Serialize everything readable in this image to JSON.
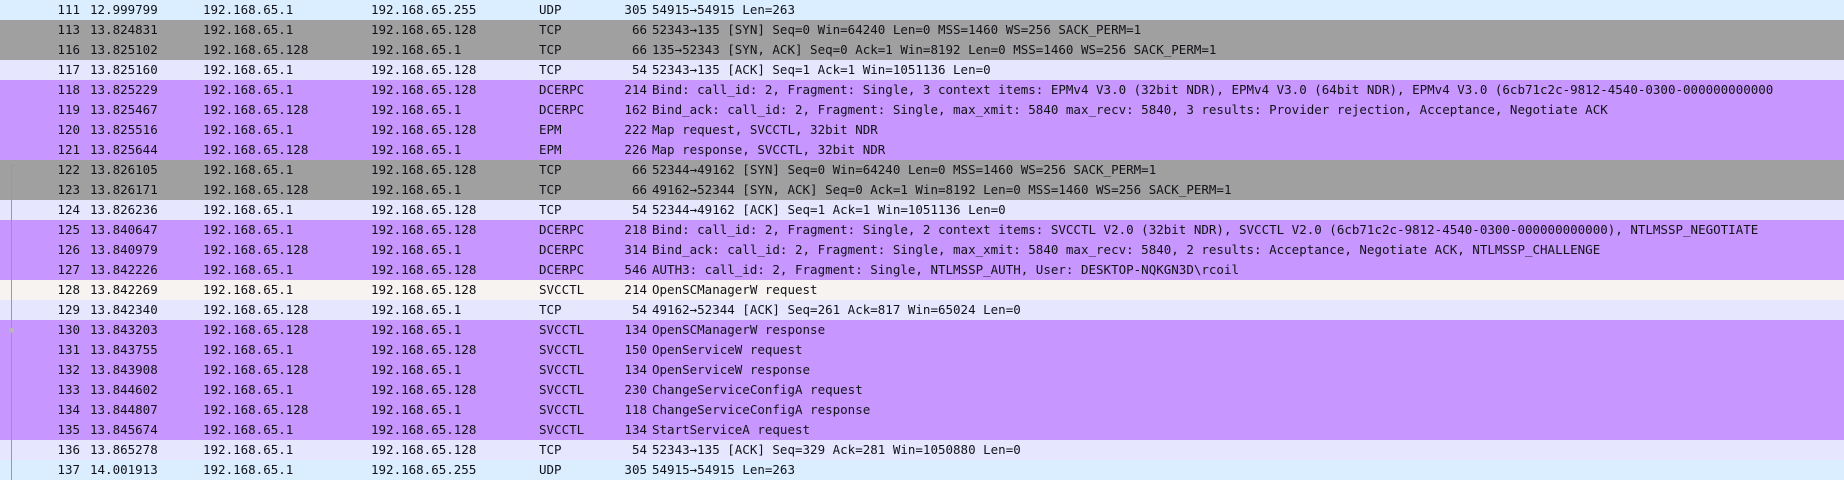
{
  "packets": [
    {
      "no": "111",
      "time": "12.999799",
      "source": "192.168.65.1",
      "destination": "192.168.65.255",
      "protocol": "UDP",
      "length": "305",
      "info": "54915→54915 Len=263",
      "color": "#daeeff"
    },
    {
      "no": "113",
      "time": "13.824831",
      "source": "192.168.65.1",
      "destination": "192.168.65.128",
      "protocol": "TCP",
      "length": "66",
      "info": "52343→135 [SYN] Seq=0 Win=64240 Len=0 MSS=1460 WS=256 SACK_PERM=1",
      "color": "#a0a0a0"
    },
    {
      "no": "116",
      "time": "13.825102",
      "source": "192.168.65.128",
      "destination": "192.168.65.1",
      "protocol": "TCP",
      "length": "66",
      "info": "135→52343 [SYN, ACK] Seq=0 Ack=1 Win=8192 Len=0 MSS=1460 WS=256 SACK_PERM=1",
      "color": "#a0a0a0"
    },
    {
      "no": "117",
      "time": "13.825160",
      "source": "192.168.65.1",
      "destination": "192.168.65.128",
      "protocol": "TCP",
      "length": "54",
      "info": "52343→135 [ACK] Seq=1 Ack=1 Win=1051136 Len=0",
      "color": "#e7e6ff"
    },
    {
      "no": "118",
      "time": "13.825229",
      "source": "192.168.65.1",
      "destination": "192.168.65.128",
      "protocol": "DCERPC",
      "length": "214",
      "info": "Bind: call_id: 2, Fragment: Single, 3 context items: EPMv4 V3.0 (32bit NDR), EPMv4 V3.0 (64bit NDR), EPMv4 V3.0 (6cb71c2c-9812-4540-0300-000000000000",
      "color": "#c797ff"
    },
    {
      "no": "119",
      "time": "13.825467",
      "source": "192.168.65.128",
      "destination": "192.168.65.1",
      "protocol": "DCERPC",
      "length": "162",
      "info": "Bind_ack: call_id: 2, Fragment: Single, max_xmit: 5840 max_recv: 5840, 3 results: Provider rejection, Acceptance, Negotiate ACK",
      "color": "#c797ff"
    },
    {
      "no": "120",
      "time": "13.825516",
      "source": "192.168.65.1",
      "destination": "192.168.65.128",
      "protocol": "EPM",
      "length": "222",
      "info": "Map request, SVCCTL, 32bit NDR",
      "color": "#c797ff"
    },
    {
      "no": "121",
      "time": "13.825644",
      "source": "192.168.65.128",
      "destination": "192.168.65.1",
      "protocol": "EPM",
      "length": "226",
      "info": "Map response, SVCCTL, 32bit NDR",
      "color": "#c797ff"
    },
    {
      "no": "122",
      "time": "13.826105",
      "source": "192.168.65.1",
      "destination": "192.168.65.128",
      "protocol": "TCP",
      "length": "66",
      "info": "52344→49162 [SYN] Seq=0 Win=64240 Len=0 MSS=1460 WS=256 SACK_PERM=1",
      "color": "#a0a0a0"
    },
    {
      "no": "123",
      "time": "13.826171",
      "source": "192.168.65.128",
      "destination": "192.168.65.1",
      "protocol": "TCP",
      "length": "66",
      "info": "49162→52344 [SYN, ACK] Seq=0 Ack=1 Win=8192 Len=0 MSS=1460 WS=256 SACK_PERM=1",
      "color": "#a0a0a0"
    },
    {
      "no": "124",
      "time": "13.826236",
      "source": "192.168.65.1",
      "destination": "192.168.65.128",
      "protocol": "TCP",
      "length": "54",
      "info": "52344→49162 [ACK] Seq=1 Ack=1 Win=1051136 Len=0",
      "color": "#e7e6ff"
    },
    {
      "no": "125",
      "time": "13.840647",
      "source": "192.168.65.1",
      "destination": "192.168.65.128",
      "protocol": "DCERPC",
      "length": "218",
      "info": "Bind: call_id: 2, Fragment: Single, 2 context items: SVCCTL V2.0 (32bit NDR), SVCCTL V2.0 (6cb71c2c-9812-4540-0300-000000000000), NTLMSSP_NEGOTIATE",
      "color": "#c797ff"
    },
    {
      "no": "126",
      "time": "13.840979",
      "source": "192.168.65.128",
      "destination": "192.168.65.1",
      "protocol": "DCERPC",
      "length": "314",
      "info": "Bind_ack: call_id: 2, Fragment: Single, max_xmit: 5840 max_recv: 5840, 2 results: Acceptance, Negotiate ACK, NTLMSSP_CHALLENGE",
      "color": "#c797ff"
    },
    {
      "no": "127",
      "time": "13.842226",
      "source": "192.168.65.1",
      "destination": "192.168.65.128",
      "protocol": "DCERPC",
      "length": "546",
      "info": "AUTH3: call_id: 2, Fragment: Single, NTLMSSP_AUTH, User: DESKTOP-NQKGN3D\\rcoil",
      "color": "#c797ff"
    },
    {
      "no": "128",
      "time": "13.842269",
      "source": "192.168.65.1",
      "destination": "192.168.65.128",
      "protocol": "SVCCTL",
      "length": "214",
      "info": "OpenSCManagerW request",
      "color": "#f6f3f0"
    },
    {
      "no": "129",
      "time": "13.842340",
      "source": "192.168.65.128",
      "destination": "192.168.65.1",
      "protocol": "TCP",
      "length": "54",
      "info": "49162→52344 [ACK] Seq=261 Ack=817 Win=65024 Len=0",
      "color": "#e7e6ff"
    },
    {
      "no": "130",
      "time": "13.843203",
      "source": "192.168.65.128",
      "destination": "192.168.65.1",
      "protocol": "SVCCTL",
      "length": "134",
      "info": "OpenSCManagerW response",
      "color": "#c797ff"
    },
    {
      "no": "131",
      "time": "13.843755",
      "source": "192.168.65.1",
      "destination": "192.168.65.128",
      "protocol": "SVCCTL",
      "length": "150",
      "info": "OpenServiceW request",
      "color": "#c797ff"
    },
    {
      "no": "132",
      "time": "13.843908",
      "source": "192.168.65.128",
      "destination": "192.168.65.1",
      "protocol": "SVCCTL",
      "length": "134",
      "info": "OpenServiceW response",
      "color": "#c797ff"
    },
    {
      "no": "133",
      "time": "13.844602",
      "source": "192.168.65.1",
      "destination": "192.168.65.128",
      "protocol": "SVCCTL",
      "length": "230",
      "info": "ChangeServiceConfigA request",
      "color": "#c797ff"
    },
    {
      "no": "134",
      "time": "13.844807",
      "source": "192.168.65.128",
      "destination": "192.168.65.1",
      "protocol": "SVCCTL",
      "length": "118",
      "info": "ChangeServiceConfigA response",
      "color": "#c797ff"
    },
    {
      "no": "135",
      "time": "13.845674",
      "source": "192.168.65.1",
      "destination": "192.168.65.128",
      "protocol": "SVCCTL",
      "length": "134",
      "info": "StartServiceA request",
      "color": "#c797ff"
    },
    {
      "no": "136",
      "time": "13.865278",
      "source": "192.168.65.1",
      "destination": "192.168.65.128",
      "protocol": "TCP",
      "length": "54",
      "info": "52343→135 [ACK] Seq=329 Ack=281 Win=1050880 Len=0",
      "color": "#e7e6ff"
    },
    {
      "no": "137",
      "time": "14.001913",
      "source": "192.168.65.1",
      "destination": "192.168.65.255",
      "protocol": "UDP",
      "length": "305",
      "info": "54915→54915 Len=263",
      "color": "#daeeff"
    }
  ]
}
